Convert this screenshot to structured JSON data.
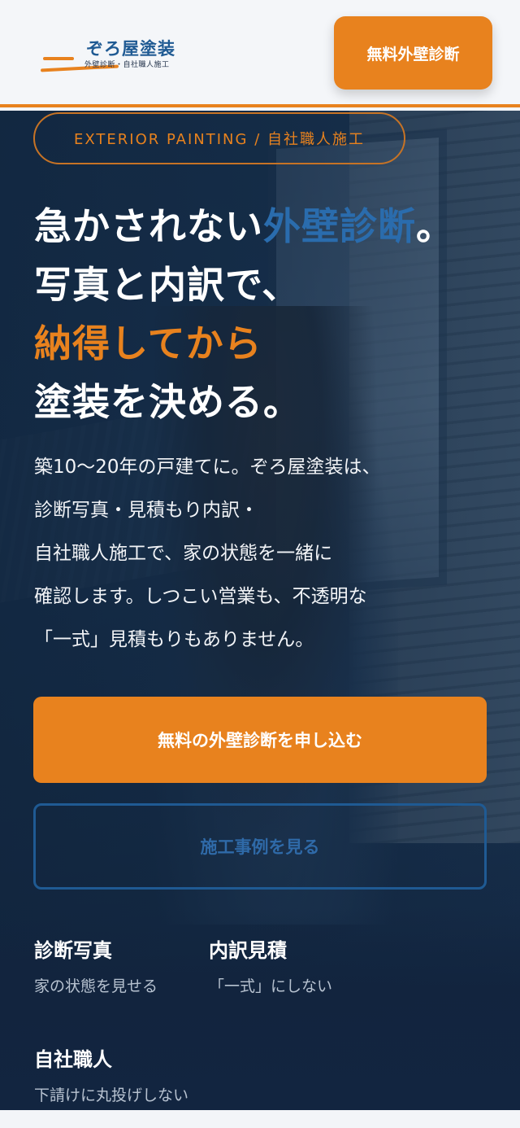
{
  "header": {
    "logo_name": "ぞろ屋塗装",
    "logo_sub": "外壁診断・自社職人施工",
    "cta_label": "無料外壁診断"
  },
  "hero": {
    "tagline": "EXTERIOR PAINTING / 自社職人施工",
    "headline": {
      "line1_pre": "急かされない",
      "line1_accent": "外壁診断",
      "line1_post": "。",
      "line2": "写真と内訳で、",
      "line3": "納得してから",
      "line4": "塗装を決める。"
    },
    "lead": [
      "築10〜20年の戸建てに。ぞろ屋塗装は、",
      "診断写真・見積もり内訳・",
      "自社職人施工で、家の状態を一緒に",
      "確認します。しつこい営業も、不透明な",
      "「一式」見積もりもありません。"
    ],
    "primary_button": "無料の外壁診断を申し込む",
    "secondary_button": "施工事例を見る",
    "features": [
      {
        "title": "診断写真",
        "desc": "家の状態を見せる"
      },
      {
        "title": "内訳見積",
        "desc": "「一式」にしない"
      },
      {
        "title": "自社職人",
        "desc": "下請けに丸投げしない"
      }
    ]
  },
  "colors": {
    "accent": "#e8821e",
    "brand_blue": "#1f5a93",
    "hero_bg": "#1a3553"
  }
}
